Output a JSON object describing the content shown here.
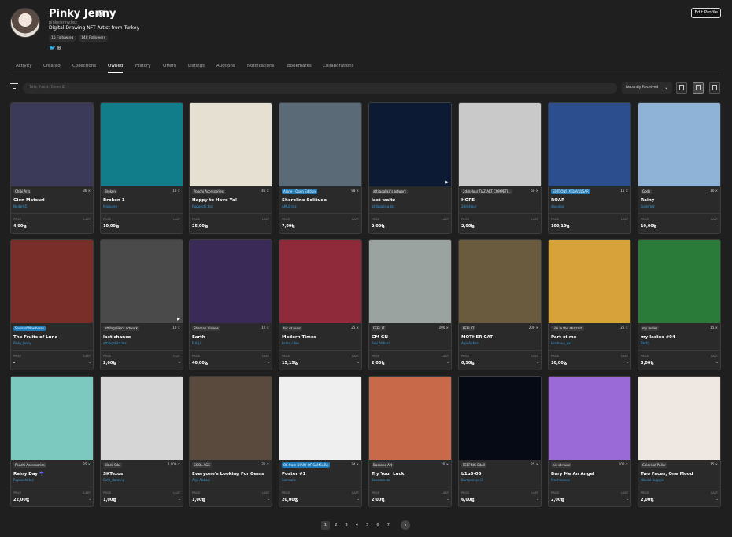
{
  "profile": {
    "name": "Pinky Jenny",
    "handle": "pinkyjenny.tez",
    "bio": "Digital Drawing NFT Artist from Turkey",
    "following": "15 Following",
    "followers": "148 Followers",
    "edit_label": "Edit Profile"
  },
  "tabs": [
    "Activity",
    "Created",
    "Collections",
    "Owned",
    "History",
    "Offers",
    "Listings",
    "Auctions",
    "Notifications",
    "Bookmarks",
    "Collaborations"
  ],
  "active_tab": "Owned",
  "search": {
    "placeholder": "Title, Artist, Token ID"
  },
  "sort": {
    "value": "Recently Received"
  },
  "card_labels": {
    "price": "PRICE",
    "last": "LAST"
  },
  "cards": [
    {
      "collection": "Chibi Arts",
      "edition": "36 ×",
      "title": "Gion Matsuri",
      "artist": "Nadar65",
      "price": "4,00ꜩ",
      "last": "-",
      "blue": false,
      "bg": "#3b3a58"
    },
    {
      "collection": "Broken",
      "edition": "10 ×",
      "title": "Broken 1",
      "artist": "Maizuren",
      "price": "10,00ꜩ",
      "last": "-",
      "blue": false,
      "bg": "#117d8a"
    },
    {
      "collection": "Poochi Accessories",
      "edition": "46 ×",
      "title": "Happy to Have Ya!",
      "artist": "Rupoochi.tez",
      "price": "25,00ꜩ",
      "last": "-",
      "blue": false,
      "bg": "#e6e0d2"
    },
    {
      "collection": "Alone - Open Edition",
      "edition": "98 ×",
      "title": "Shoreline Solitude",
      "artist": "AMLB.tez",
      "price": "7,00ꜩ",
      "last": "-",
      "blue": true,
      "bg": "#5a6a76"
    },
    {
      "collection": "attilagalika's artwork",
      "edition": "",
      "title": "last waltz",
      "artist": "attilagalika.tez",
      "price": "2,00ꜩ",
      "last": "-",
      "blue": false,
      "bg": "#0d1a33"
    },
    {
      "collection": "2ddsHour T&Z ART COMPETI...",
      "edition": "50 ×",
      "title": "HOPE",
      "artist": "2ddsHour",
      "price": "2,00ꜩ",
      "last": "-",
      "blue": false,
      "bg": "#c9c9c9"
    },
    {
      "collection": "EDITIONS X DAVULSAR",
      "edition": "15 ×",
      "title": "ROAR",
      "artist": "davulsar",
      "price": "100,10ꜩ",
      "last": "-",
      "blue": true,
      "bg": "#2c4d8e"
    },
    {
      "collection": "Gods",
      "edition": "10 ×",
      "title": "Rainy",
      "artist": "Gods.tez",
      "price": "10,00ꜩ",
      "last": "-",
      "blue": false,
      "bg": "#8fb3d6"
    },
    {
      "collection": "Souls of Nowheres",
      "edition": "",
      "title": "The Fruits of Luna",
      "artist": "Pinky Jenny",
      "price": "-",
      "last": "-",
      "blue": true,
      "bg": "#7a2e2a"
    },
    {
      "collection": "attilagalika's artwork",
      "edition": "10 ×",
      "title": "last chance",
      "artist": "attilagalika.tez",
      "price": "2,00ꜩ",
      "last": "-",
      "blue": false,
      "bg": "#4a4a4a"
    },
    {
      "collection": "Shaman Visions",
      "edition": "10 ×",
      "title": "Earth",
      "artist": "R.A.J.I.",
      "price": "40,00ꜩ",
      "last": "-",
      "blue": false,
      "bg": "#3a2a58"
    },
    {
      "collection": "hic et nunc",
      "edition": "25 ×",
      "title": "Modern Times",
      "artist": "Lorax / des",
      "price": "15,15ꜩ",
      "last": "-",
      "blue": false,
      "bg": "#8e2a3a"
    },
    {
      "collection": "FEEL IT",
      "edition": "200 ×",
      "title": "GM GN",
      "artist": "Arpi Abbasi",
      "price": "2,00ꜩ",
      "last": "-",
      "blue": false,
      "bg": "#9aa3a0"
    },
    {
      "collection": "FEEL IT",
      "edition": "200 ×",
      "title": "MOTHER CAT",
      "artist": "Arpi Abbasi",
      "price": "0,50ꜩ",
      "last": "-",
      "blue": false,
      "bg": "#6a5a3e"
    },
    {
      "collection": "Life in the abstract",
      "edition": "25 ×",
      "title": "Part of me",
      "artist": "kocaleva_pxl",
      "price": "10,00ꜩ",
      "last": "-",
      "blue": false,
      "bg": "#d8a23a"
    },
    {
      "collection": "my ladies",
      "edition": "15 ×",
      "title": "my ladies #04",
      "artist": "Bettij",
      "price": "3,00ꜩ",
      "last": "-",
      "blue": false,
      "bg": "#2a7a3a"
    },
    {
      "collection": "Poochi Accessories",
      "edition": "35 ×",
      "title": "Rainy Day ☂️",
      "artist": "Rupoochi.tez",
      "price": "22,00ꜩ",
      "last": "-",
      "blue": false,
      "bg": "#7cc9c0"
    },
    {
      "collection": "Black Sdx",
      "edition": "2,000 ×",
      "title": "SKTezos",
      "artist": "Cath_dancing",
      "price": "1,00ꜩ",
      "last": "-",
      "blue": false,
      "bg": "#d6d6d6"
    },
    {
      "collection": "COOL AGE",
      "edition": "35 ×",
      "title": "Everyone's Looking For Gems",
      "artist": "Arpi Abbasi",
      "price": "1,00ꜩ",
      "last": "-",
      "blue": false,
      "bg": "#5a4a3e"
    },
    {
      "collection": "OE from DIARY OF SAMSARA",
      "edition": "24 ×",
      "title": "Poster #1",
      "artist": "Samsara",
      "price": "20,00ꜩ",
      "last": "-",
      "blue": true,
      "bg": "#efefef"
    },
    {
      "collection": "Bassano Art",
      "edition": "20 ×",
      "title": "Try Your Luck",
      "artist": "Bassano.tez",
      "price": "2,00ꜩ",
      "last": "-",
      "blue": false,
      "bg": "#c86a4a"
    },
    {
      "collection": "FEEFING Edall",
      "edition": "25 ×",
      "title": "b1u3-06",
      "artist": "Bumpsneyer3",
      "price": "6,00ꜩ",
      "last": "-",
      "blue": false,
      "bg": "#050a14"
    },
    {
      "collection": "hic et nunc",
      "edition": "100 ×",
      "title": "Bury Me An Angel",
      "artist": "Machinanas",
      "price": "2,00ꜩ",
      "last": "-",
      "blue": false,
      "bg": "#9a6ad6"
    },
    {
      "collection": "Colors of Pallor",
      "edition": "15 ×",
      "title": "Two Faces, One Mood",
      "artist": "Nikolai Kulygin",
      "price": "2,00ꜩ",
      "last": "-",
      "blue": false,
      "bg": "#eee7e2"
    }
  ],
  "pagination": [
    "1",
    "2",
    "3",
    "4",
    "5",
    "6",
    "7"
  ],
  "current_page": "1"
}
